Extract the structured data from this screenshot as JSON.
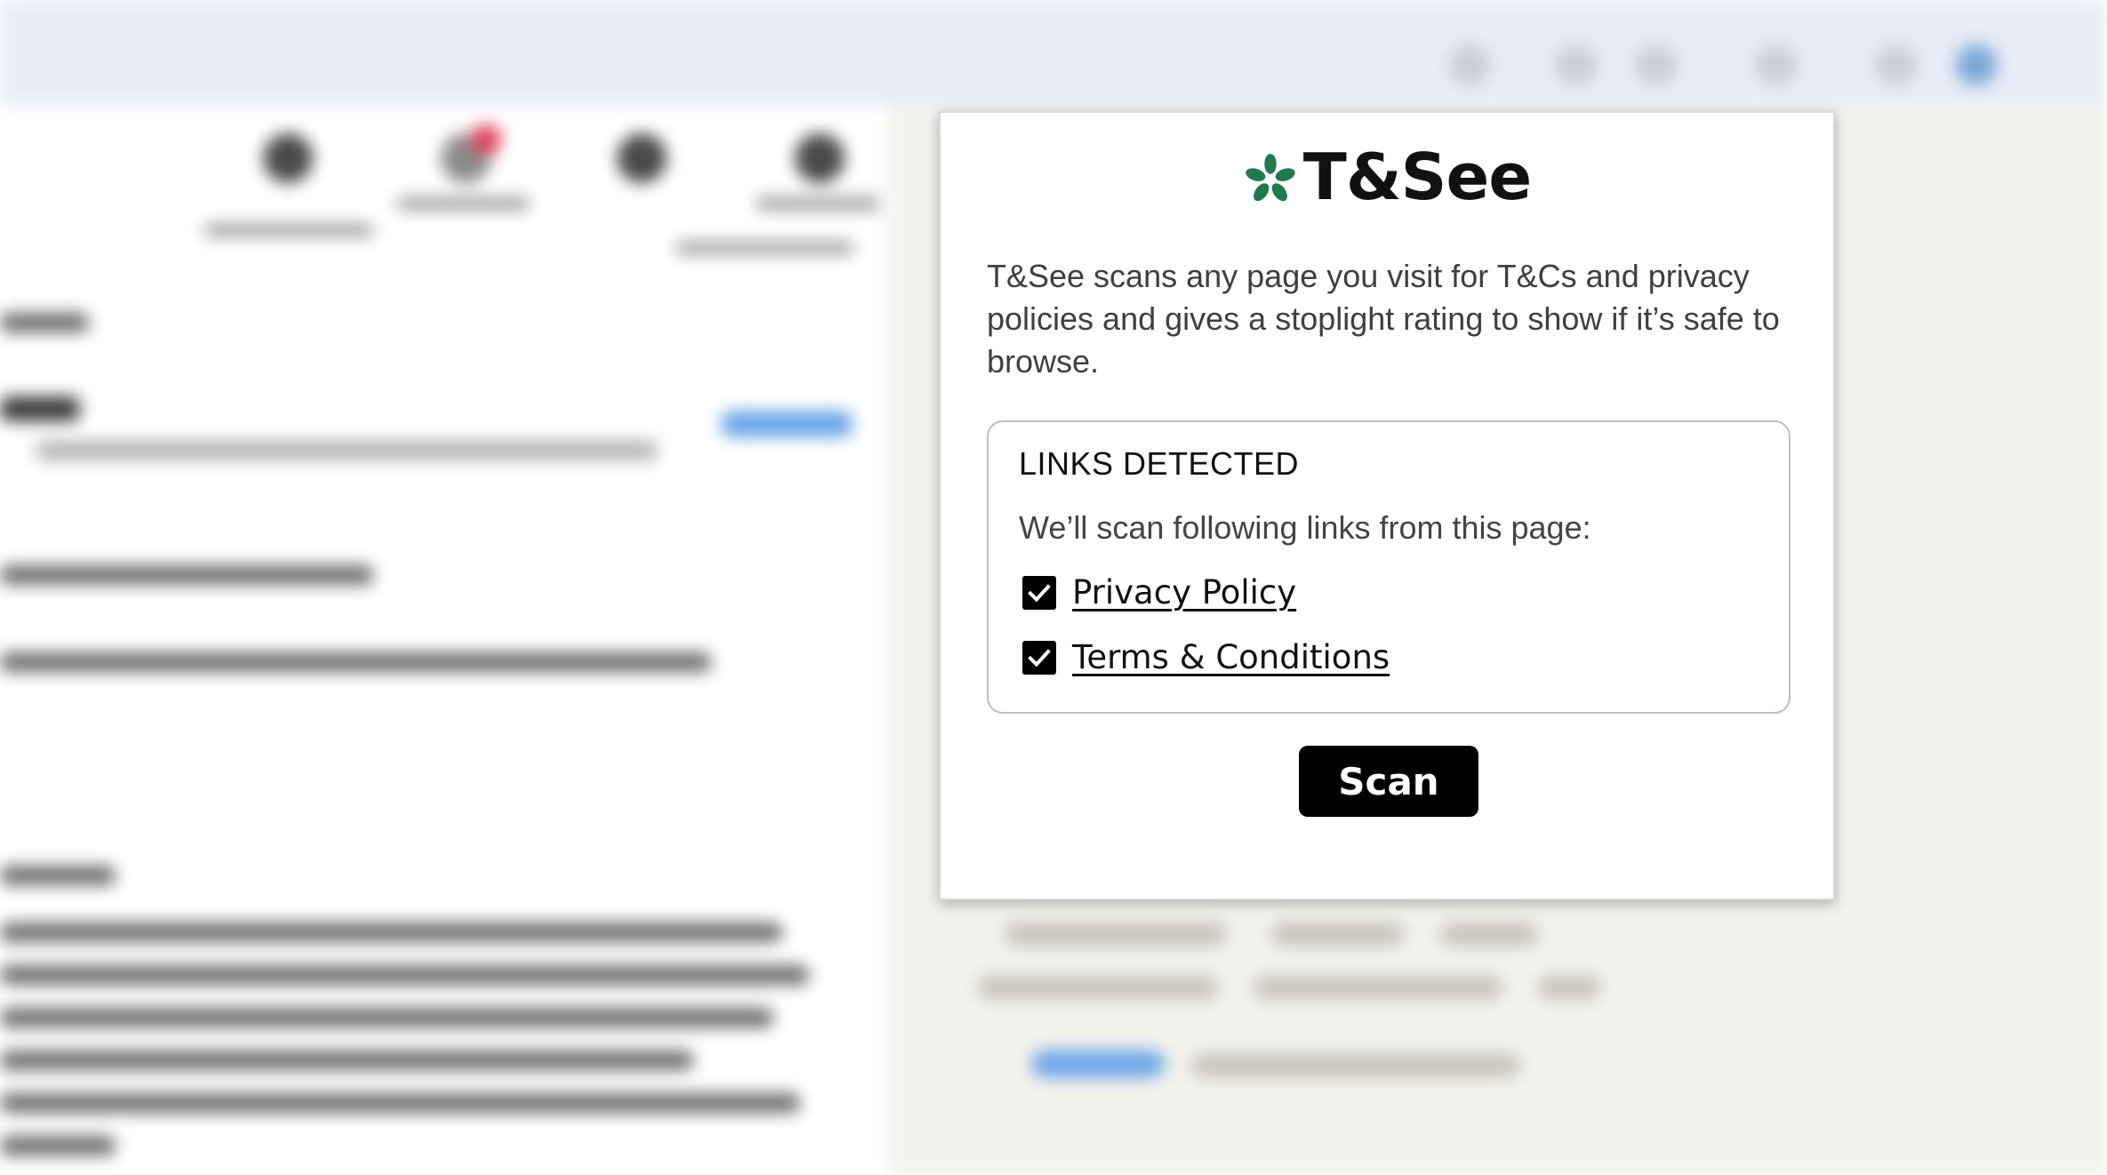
{
  "popup": {
    "brand": {
      "name": "T&See",
      "logo_icon": "green-flower-icon",
      "logo_color": "#1f7a4d"
    },
    "description": "T&See scans any page you visit for T&Cs and privacy policies and gives a stoplight rating to show if it’s safe to browse.",
    "links_section": {
      "title": "LINKS DETECTED",
      "subtitle": "We’ll scan following links from this page:",
      "links": [
        {
          "label": "Privacy Policy",
          "checked": true
        },
        {
          "label": "Terms & Conditions",
          "checked": true
        }
      ]
    },
    "scan_button": {
      "label": "Scan"
    }
  }
}
